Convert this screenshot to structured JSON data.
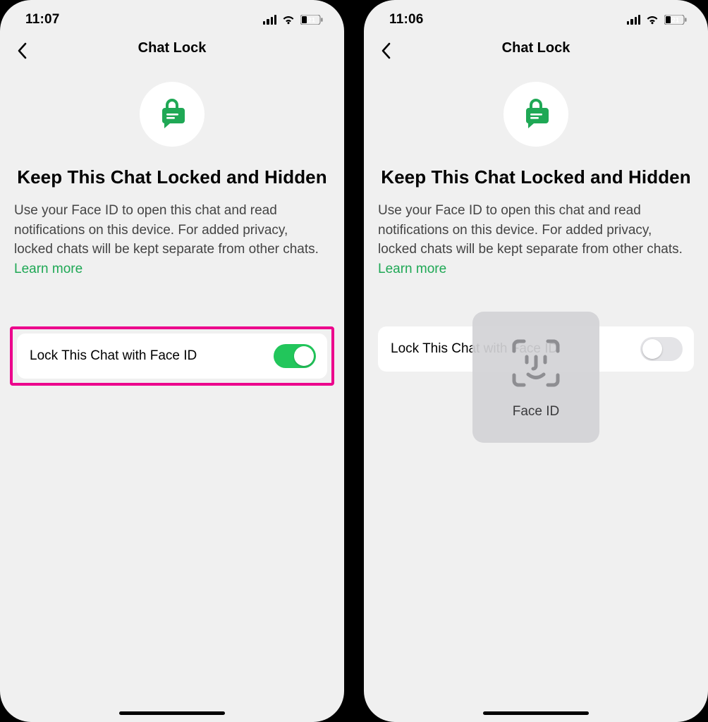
{
  "left": {
    "status": {
      "time": "11:07",
      "battery": "21"
    },
    "nav_title": "Chat Lock",
    "heading": "Keep This Chat Locked and Hidden",
    "desc_part1": "Use your Face ID to open this chat and read notifications on this device. For added privacy, locked chats will be kept separate from other chats. ",
    "learn": "Learn more",
    "setting_label": "Lock This Chat with Face ID",
    "toggle_on": true
  },
  "right": {
    "status": {
      "time": "11:06",
      "battery": "21"
    },
    "nav_title": "Chat Lock",
    "heading": "Keep This Chat Locked and Hidden",
    "desc_part1": "Use your Face ID to open this chat and read notifications on this device. For added privacy, locked chats will be kept separate from other chats. ",
    "learn": "Learn more",
    "setting_label": "Lock This Chat with Face ID",
    "toggle_on": false,
    "faceid_label": "Face ID"
  },
  "colors": {
    "accent_green": "#1fa855",
    "toggle_on": "#22c65b",
    "highlight_pink": "#ec008c"
  }
}
